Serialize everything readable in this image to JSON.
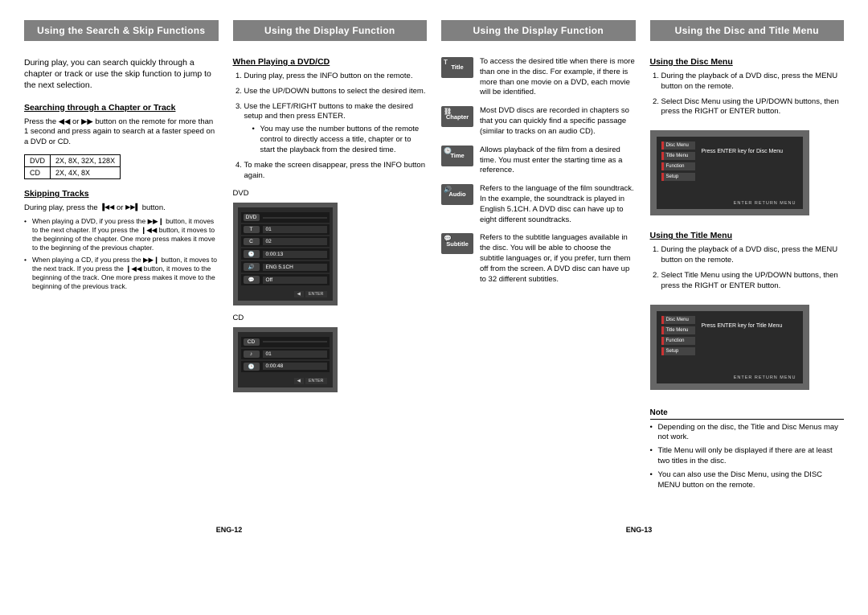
{
  "headers": {
    "h1": "Using the Search & Skip Functions",
    "h2": "Using the Display Function",
    "h3": "Using the Display Function",
    "h4": "Using the Disc and Title Menu"
  },
  "col1": {
    "intro": "During play, you can search quickly through a chapter or track or use the skip function to jump to the next selection.",
    "sub1": "Searching through a Chapter or Track",
    "search_body": "Press the ◀◀ or ▶▶ button on the remote for more than 1 second and press again to search at a faster speed on a DVD or CD.",
    "table": {
      "r1c1": "DVD",
      "r1c2": "2X, 8X, 32X, 128X",
      "r2c1": "CD",
      "r2c2": "2X, 4X, 8X"
    },
    "sub2": "Skipping Tracks",
    "skip_line_a": "During play, press the ",
    "skip_line_b": " or ",
    "skip_line_c": " button.",
    "bul1": "When playing a DVD, if you press the ▶▶❙ button, it moves to the next chapter. If you press the ❙◀◀ button, it moves to the beginning of the chapter. One more press makes it move to the beginning of the previous chapter.",
    "bul2": "When playing a CD, if you press the ▶▶❙ button, it moves to the next track. If you press the ❙◀◀ button, it moves to the beginning of the track. One more press makes it move to the beginning of the previous track."
  },
  "col2": {
    "sub": "When Playing a DVD/CD",
    "s1": "During play, press the INFO button on the remote.",
    "s2": "Use the UP/DOWN buttons to select the desired item.",
    "s3": "Use the LEFT/RIGHT buttons to make the desired setup and then press ENTER.",
    "s3b": "You may use the number buttons of the remote control to directly access a title, chapter or to start the playback from the desired time.",
    "s4": "To make the screen disappear, press the INFO button again.",
    "lbl_dvd": "DVD",
    "lbl_cd": "CD",
    "osd_dvd": {
      "r1": "DVD",
      "v1": "",
      "r2": "T",
      "v2": "01",
      "r3": "C",
      "v3": "02",
      "r4": "",
      "v4": "0:00:13",
      "r5": "",
      "v5": "ENG 5.1CH",
      "r6": "",
      "v6": "Off",
      "btn_enter": "ENTER"
    },
    "osd_cd": {
      "r1": "CD",
      "v1": "",
      "r2": "",
      "v2": "01",
      "r3": "",
      "v3": "0:00:48",
      "btn_enter": "ENTER"
    }
  },
  "col3": {
    "title": {
      "badge": "Title",
      "text": "To access the desired title when there is more than one in the disc. For example, if there is more than one movie on a DVD, each movie will be identified."
    },
    "chapter": {
      "badge": "Chapter",
      "text": "Most DVD discs are recorded in chapters so that you can quickly find a specific passage (similar to tracks on an audio CD)."
    },
    "time": {
      "badge": "Time",
      "text": "Allows playback of the film from a desired time. You must enter the starting time as a reference."
    },
    "audio": {
      "badge": "Audio",
      "text": "Refers to the language of the film soundtrack. In the example, the soundtrack is played in English 5.1CH. A DVD disc can have up to eight different soundtracks."
    },
    "subtitle": {
      "badge": "Subtitle",
      "text": "Refers to the subtitle languages available in the disc. You will be able to choose the subtitle languages or, if you prefer, turn them off from the screen. A DVD disc can have up to 32 different subtitles."
    }
  },
  "col4": {
    "sub1": "Using the Disc Menu",
    "s1": "During the playback of a DVD disc, press the MENU button on the remote.",
    "s2": "Select Disc Menu using the UP/DOWN buttons, then press the RIGHT or ENTER button.",
    "menu1": {
      "items": [
        "Disc Menu",
        "Title Menu",
        "Function",
        "Setup"
      ],
      "hint": "Press ENTER key for Disc Menu",
      "foot": "ENTER    RETURN    MENU"
    },
    "sub2": "Using the Title Menu",
    "t1": "During the playback of a DVD disc, press the MENU button on the remote.",
    "t2": "Select Title Menu using the UP/DOWN buttons, then press the RIGHT or ENTER button.",
    "menu2": {
      "items": [
        "Disc Menu",
        "Title Menu",
        "Function",
        "Setup"
      ],
      "hint": "Press ENTER key for Title Menu",
      "foot": "ENTER    RETURN    MENU"
    },
    "note_head": "Note",
    "n1": "Depending on the disc, the Title and Disc Menus may not work.",
    "n2": "Title Menu will only be displayed if there are at least two titles in the disc.",
    "n3": "You can also use the Disc Menu, using the DISC MENU button on the remote."
  },
  "pagenums": {
    "left": "ENG-12",
    "right": "ENG-13"
  }
}
